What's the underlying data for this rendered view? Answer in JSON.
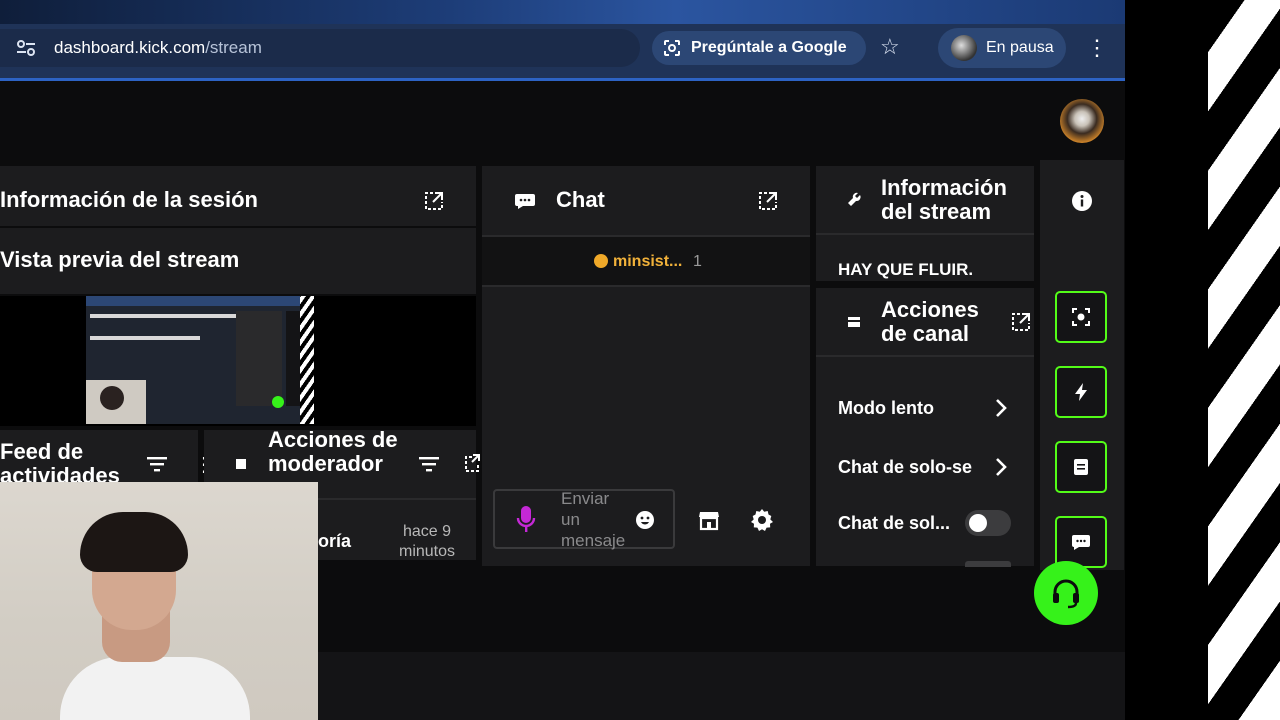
{
  "browser": {
    "url_host": "dashboard.kick.com",
    "url_path": "/stream",
    "ask_google": "Pregúntale a Google",
    "profile_label": "En pausa"
  },
  "session": {
    "title": "Información de la sesión",
    "preview_title": "Vista previa del stream",
    "activity_feed": "Feed de actividades",
    "mod_actions": "Acciones de moderador",
    "feed_item_label": "oría",
    "feed_item_time": "hace 9 minutos"
  },
  "chat": {
    "title": "Chat",
    "pinned_user": "minsist...",
    "pinned_count": "1",
    "input_placeholder": "Enviar un mensaje"
  },
  "stream_info": {
    "title": "Información del stream",
    "stream_title": "HAY QUE FLUIR."
  },
  "channel_actions": {
    "title": "Acciones de canal",
    "items": [
      "Modo lento",
      "Chat de solo-se",
      "Chat de sol..."
    ]
  },
  "colors": {
    "accent": "#53fc18",
    "address_bar": "#1f3358"
  }
}
